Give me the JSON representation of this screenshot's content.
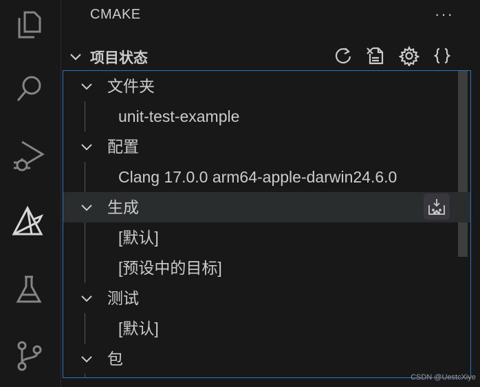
{
  "activity_bar": {
    "items": [
      {
        "icon": "files-icon"
      },
      {
        "icon": "search-icon"
      },
      {
        "icon": "run-debug-icon"
      },
      {
        "icon": "cmake-icon"
      },
      {
        "icon": "testing-flask-icon"
      },
      {
        "icon": "source-control-icon"
      }
    ]
  },
  "sidebar": {
    "title": "CMAKE",
    "more": "···"
  },
  "section": {
    "title": "项目状态",
    "actions": [
      "refresh-icon",
      "delete-cache-icon",
      "settings-gear-icon",
      "braces-icon"
    ]
  },
  "tree": {
    "rows": [
      {
        "label": "文件夹",
        "type": "parent"
      },
      {
        "label": "unit-test-example",
        "type": "child"
      },
      {
        "label": "配置",
        "type": "parent"
      },
      {
        "label": "Clang 17.0.0 arm64-apple-darwin24.6.0",
        "type": "child"
      },
      {
        "label": "生成",
        "type": "parent",
        "hover": true
      },
      {
        "label": "[默认]",
        "type": "child"
      },
      {
        "label": "[预设中的目标]",
        "type": "child"
      },
      {
        "label": "测试",
        "type": "parent"
      },
      {
        "label": "[默认]",
        "type": "child"
      },
      {
        "label": "包",
        "type": "parent"
      }
    ]
  },
  "watermark": "CSDN @UestcXiye",
  "colors": {
    "focus_border": "#2a76c6",
    "background": "#181818",
    "hover_row": "#2a2d2e"
  }
}
